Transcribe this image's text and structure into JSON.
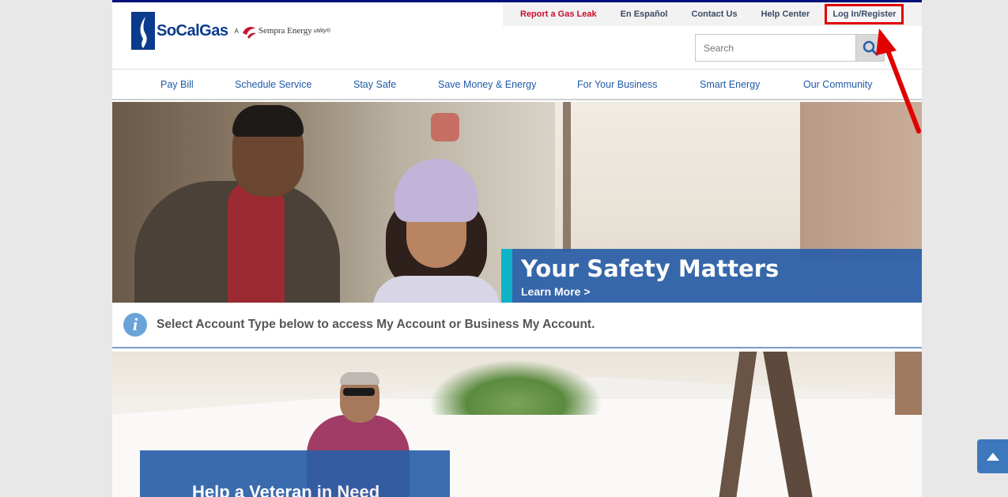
{
  "utility_nav": {
    "report_leak": "Report a Gas Leak",
    "espanol": "En Español",
    "contact": "Contact Us",
    "help": "Help Center",
    "login": "Log In/Register"
  },
  "logo": {
    "brand": "SoCalGas",
    "prefix": "A",
    "parent": "Sempra Energy",
    "suffix": "utility®"
  },
  "search": {
    "placeholder": "Search"
  },
  "main_nav": [
    "Pay Bill",
    "Schedule Service",
    "Stay Safe",
    "Save Money & Energy",
    "For Your Business",
    "Smart Energy",
    "Our Community"
  ],
  "hero": {
    "title": "Your Safety Matters",
    "link": "Learn More >"
  },
  "info_bar": {
    "icon": "i",
    "text": "Select Account Type below to access My Account or Business My Account."
  },
  "promo2": {
    "title": "Help a Veteran in Need"
  },
  "colors": {
    "brand_blue": "#0a3b8c",
    "nav_link": "#1f5aa6",
    "promo_blue": "#2a5fa8",
    "accent_teal": "#00b2c8",
    "leak_red": "#c8102e",
    "annotation_red": "#e00000"
  },
  "icons": {
    "search": "search-icon",
    "info": "info-icon",
    "back_to_top": "chevron-up-icon"
  }
}
